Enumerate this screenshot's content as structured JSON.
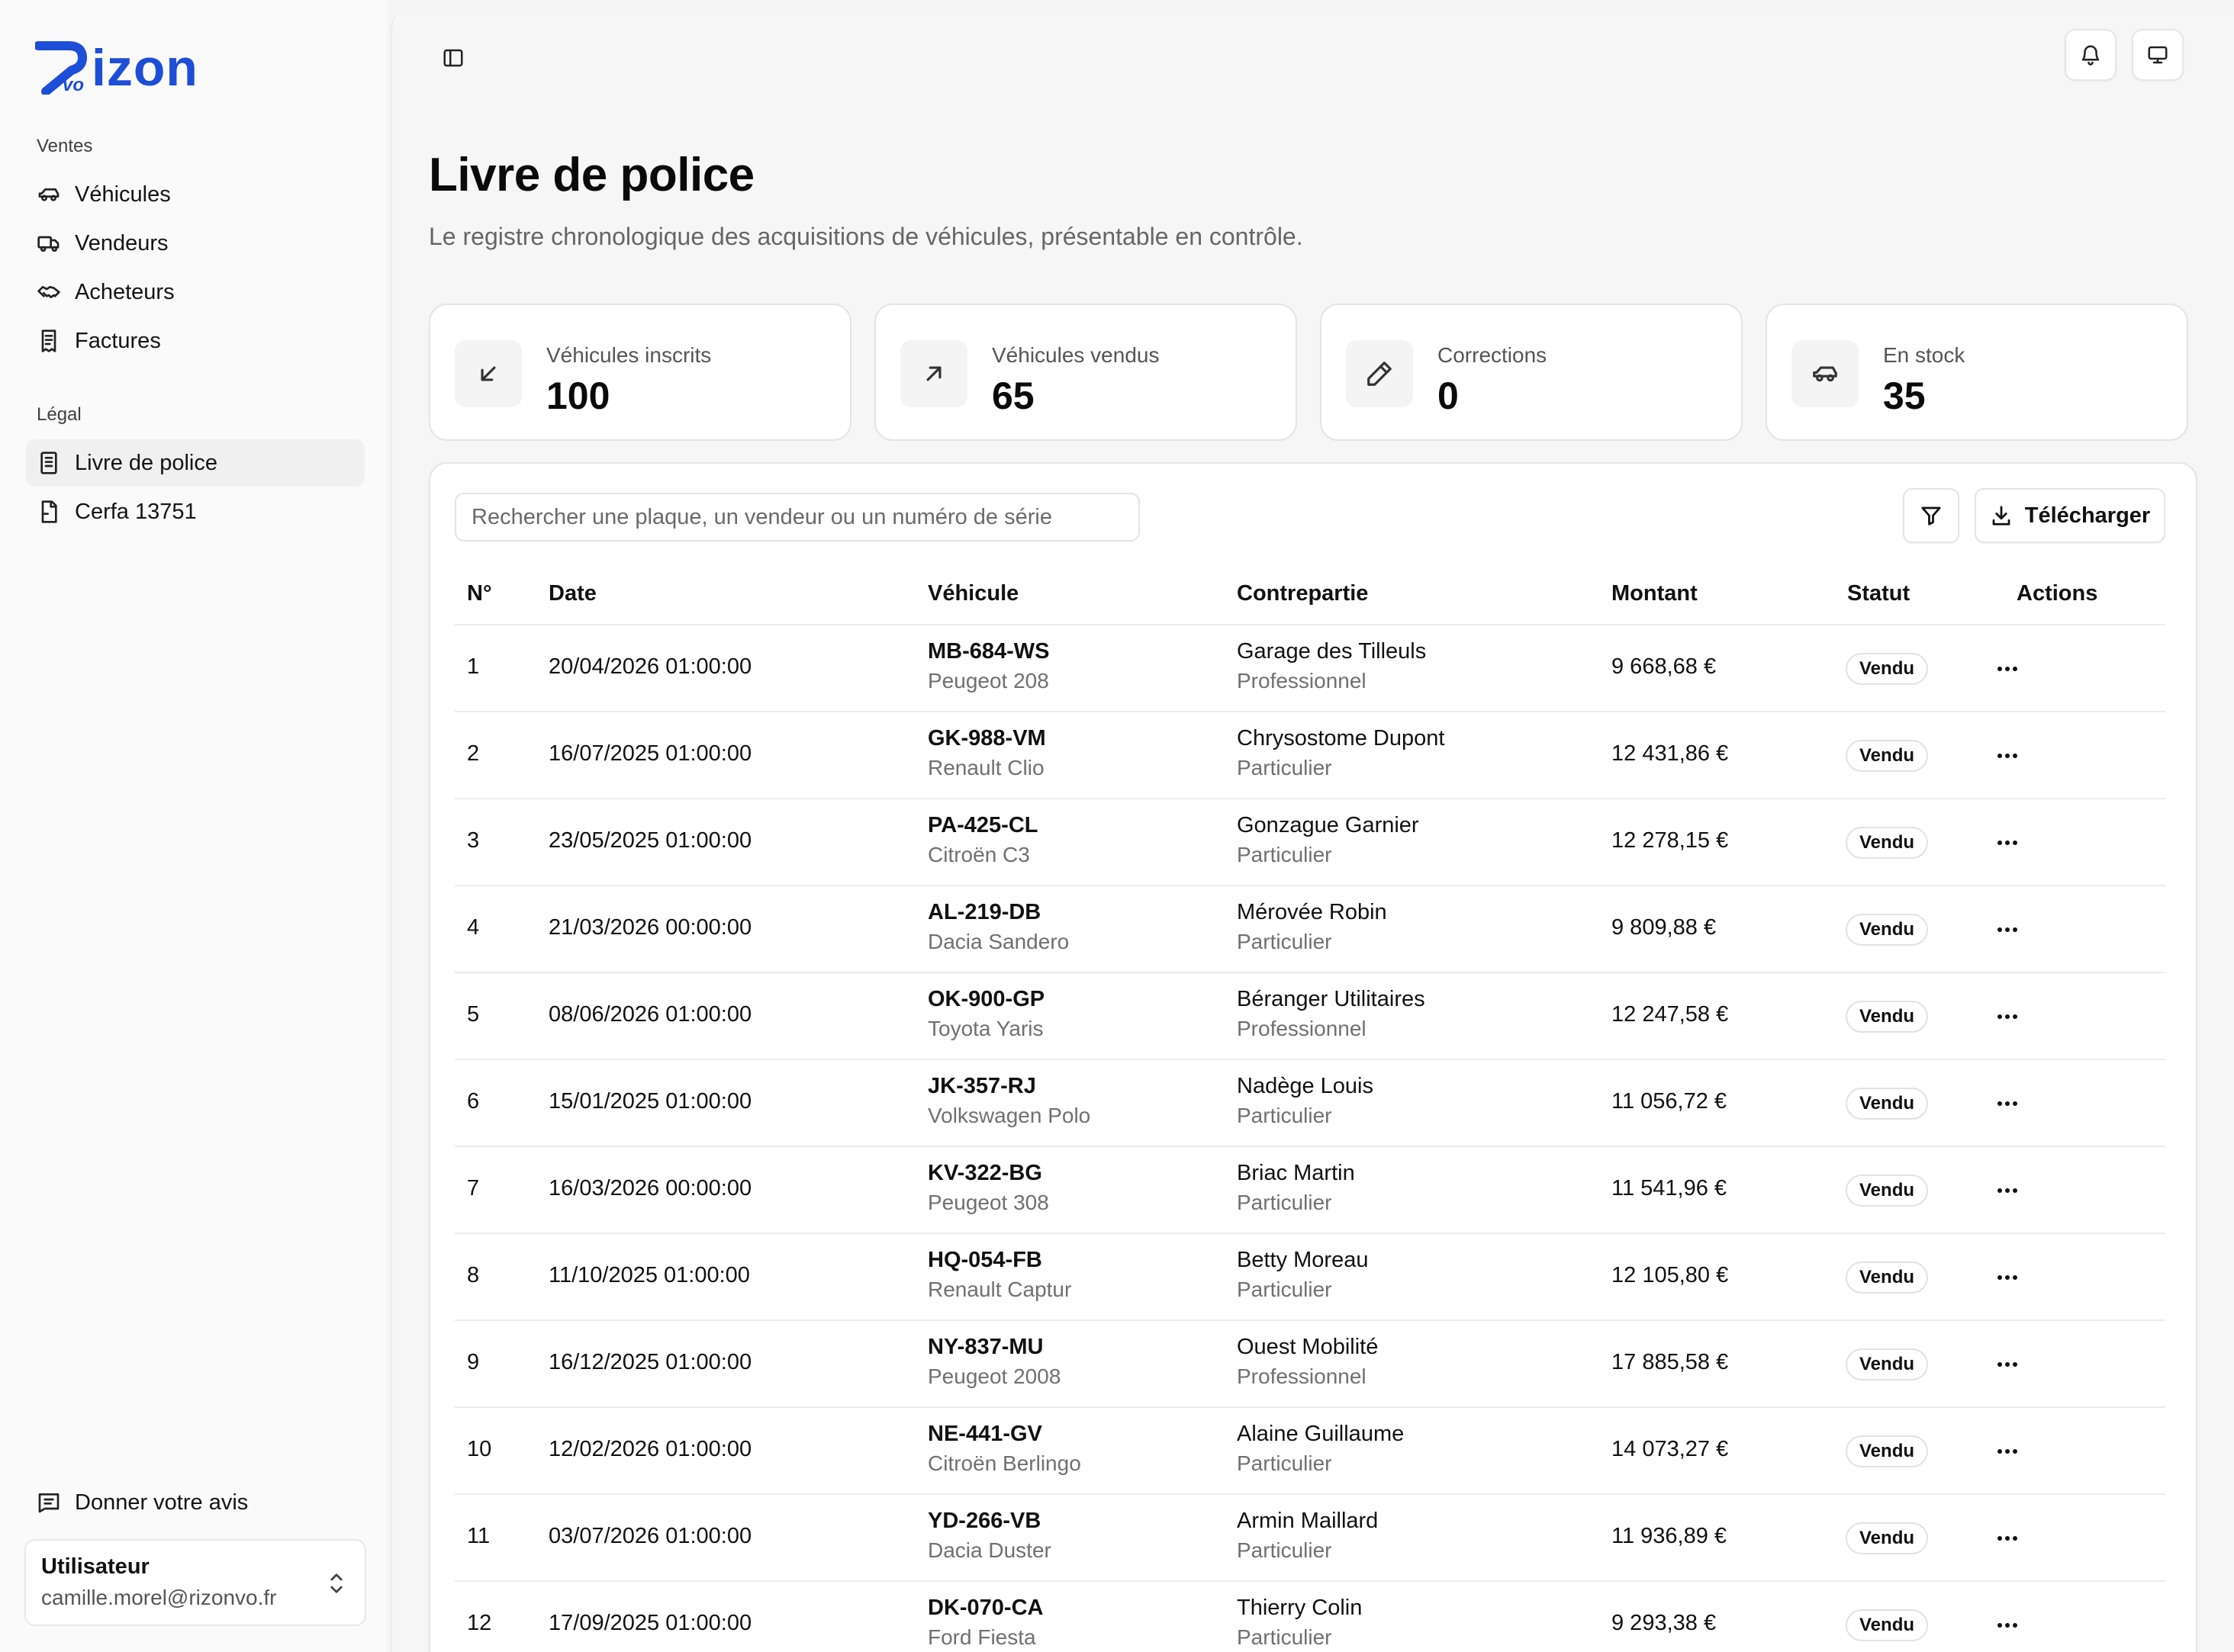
{
  "brand": {
    "name": "izon",
    "mark_sub": "vo",
    "accent": "#1d4ed8"
  },
  "sidebar": {
    "groups": [
      {
        "label": "Ventes",
        "items": [
          {
            "label": "Véhicules",
            "icon": "car-icon"
          },
          {
            "label": "Vendeurs",
            "icon": "truck-icon"
          },
          {
            "label": "Acheteurs",
            "icon": "handshake-icon"
          },
          {
            "label": "Factures",
            "icon": "receipt-icon"
          }
        ]
      },
      {
        "label": "Légal",
        "items": [
          {
            "label": "Livre de police",
            "icon": "book-icon",
            "active": true
          },
          {
            "label": "Cerfa 13751",
            "icon": "file-icon"
          }
        ]
      }
    ],
    "feedback_label": "Donner votre avis",
    "user": {
      "name": "Utilisateur",
      "email": "camille.morel@rizonvo.fr"
    }
  },
  "page": {
    "title": "Livre de police",
    "subtitle": "Le registre chronologique des acquisitions de véhicules, présentable en contrôle."
  },
  "stats": [
    {
      "label": "Véhicules inscrits",
      "value": "100",
      "icon": "arrow-down-left-icon"
    },
    {
      "label": "Véhicules vendus",
      "value": "65",
      "icon": "arrow-up-right-icon"
    },
    {
      "label": "Corrections",
      "value": "0",
      "icon": "pencil-icon"
    },
    {
      "label": "En stock",
      "value": "35",
      "icon": "car-icon"
    }
  ],
  "table": {
    "search_placeholder": "Rechercher une plaque, un vendeur ou un numéro de série",
    "download_label": "Télécharger",
    "headers": {
      "num": "N°",
      "date": "Date",
      "vehicle": "Véhicule",
      "party": "Contrepartie",
      "amount": "Montant",
      "status": "Statut",
      "actions": "Actions"
    },
    "rows": [
      {
        "num": "1",
        "date": "20/04/2026 01:00:00",
        "plate": "MB-684-WS",
        "model": "Peugeot 208",
        "party": "Garage des Tilleuls",
        "party_type": "Professionnel",
        "amount": "9 668,68 €",
        "status": "Vendu"
      },
      {
        "num": "2",
        "date": "16/07/2025 01:00:00",
        "plate": "GK-988-VM",
        "model": "Renault Clio",
        "party": "Chrysostome Dupont",
        "party_type": "Particulier",
        "amount": "12 431,86 €",
        "status": "Vendu"
      },
      {
        "num": "3",
        "date": "23/05/2025 01:00:00",
        "plate": "PA-425-CL",
        "model": "Citroën C3",
        "party": "Gonzague Garnier",
        "party_type": "Particulier",
        "amount": "12 278,15 €",
        "status": "Vendu"
      },
      {
        "num": "4",
        "date": "21/03/2026 00:00:00",
        "plate": "AL-219-DB",
        "model": "Dacia Sandero",
        "party": "Mérovée Robin",
        "party_type": "Particulier",
        "amount": "9 809,88 €",
        "status": "Vendu"
      },
      {
        "num": "5",
        "date": "08/06/2026 01:00:00",
        "plate": "OK-900-GP",
        "model": "Toyota Yaris",
        "party": "Béranger Utilitaires",
        "party_type": "Professionnel",
        "amount": "12 247,58 €",
        "status": "Vendu"
      },
      {
        "num": "6",
        "date": "15/01/2025 01:00:00",
        "plate": "JK-357-RJ",
        "model": "Volkswagen Polo",
        "party": "Nadège Louis",
        "party_type": "Particulier",
        "amount": "11 056,72 €",
        "status": "Vendu"
      },
      {
        "num": "7",
        "date": "16/03/2026 00:00:00",
        "plate": "KV-322-BG",
        "model": "Peugeot 308",
        "party": "Briac Martin",
        "party_type": "Particulier",
        "amount": "11 541,96 €",
        "status": "Vendu"
      },
      {
        "num": "8",
        "date": "11/10/2025 01:00:00",
        "plate": "HQ-054-FB",
        "model": "Renault Captur",
        "party": "Betty Moreau",
        "party_type": "Particulier",
        "amount": "12 105,80 €",
        "status": "Vendu"
      },
      {
        "num": "9",
        "date": "16/12/2025 01:00:00",
        "plate": "NY-837-MU",
        "model": "Peugeot 2008",
        "party": "Ouest Mobilité",
        "party_type": "Professionnel",
        "amount": "17 885,58 €",
        "status": "Vendu"
      },
      {
        "num": "10",
        "date": "12/02/2026 01:00:00",
        "plate": "NE-441-GV",
        "model": "Citroën Berlingo",
        "party": "Alaine Guillaume",
        "party_type": "Particulier",
        "amount": "14 073,27 €",
        "status": "Vendu"
      },
      {
        "num": "11",
        "date": "03/07/2026 01:00:00",
        "plate": "YD-266-VB",
        "model": "Dacia Duster",
        "party": "Armin Maillard",
        "party_type": "Particulier",
        "amount": "11 936,89 €",
        "status": "Vendu"
      },
      {
        "num": "12",
        "date": "17/09/2025 01:00:00",
        "plate": "DK-070-CA",
        "model": "Ford Fiesta",
        "party": "Thierry Colin",
        "party_type": "Particulier",
        "amount": "9 293,38 €",
        "status": "Vendu"
      }
    ]
  }
}
